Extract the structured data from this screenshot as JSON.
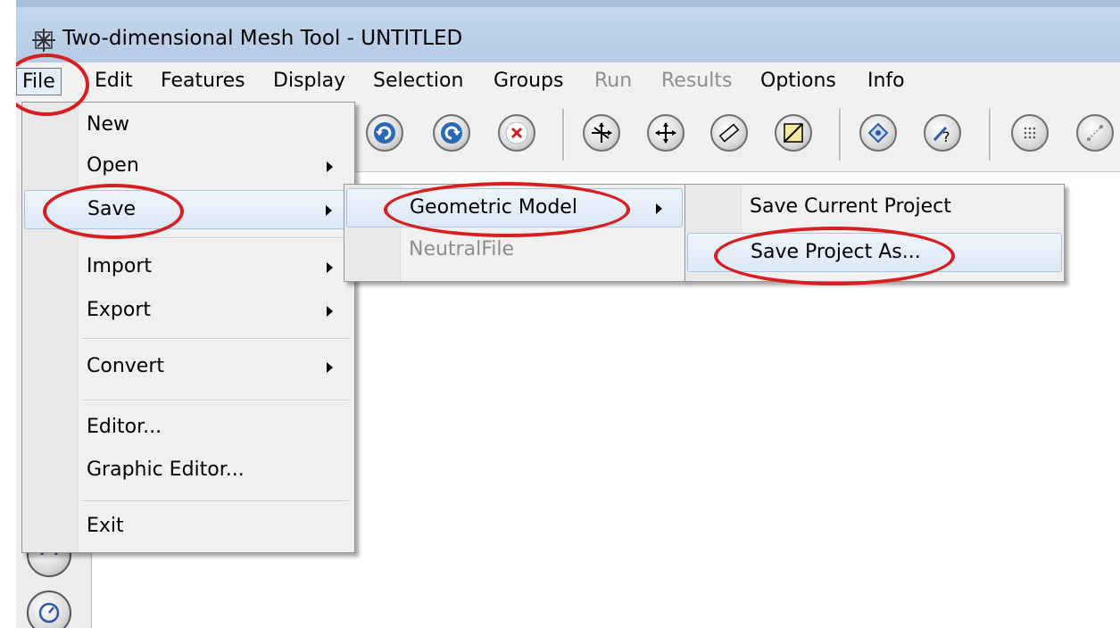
{
  "window": {
    "title": "Two-dimensional Mesh Tool - UNTITLED",
    "icon": "mesh-app-icon"
  },
  "menubar": {
    "items": [
      {
        "label": "File",
        "state": "active"
      },
      {
        "label": "Edit"
      },
      {
        "label": "Features"
      },
      {
        "label": "Display"
      },
      {
        "label": "Selection"
      },
      {
        "label": "Groups"
      },
      {
        "label": "Run",
        "state": "disabled"
      },
      {
        "label": "Results",
        "state": "disabled"
      },
      {
        "label": "Options"
      },
      {
        "label": "Info"
      }
    ]
  },
  "toolbar": {
    "buttons": [
      "undo-icon",
      "redo-icon",
      "delete-icon",
      "move-icon",
      "pan-icon",
      "measure-icon",
      "split-area-icon",
      "view-icon",
      "query-icon",
      "grid-icon",
      "snap-icon"
    ]
  },
  "file_menu": {
    "items": [
      {
        "label": "New"
      },
      {
        "label": "Open",
        "submenu": true
      },
      {
        "label": "Save",
        "submenu": true,
        "highlighted": true
      },
      {
        "label": "Import",
        "submenu": true
      },
      {
        "label": "Export",
        "submenu": true
      },
      {
        "label": "Convert",
        "submenu": true
      },
      {
        "label": "Editor..."
      },
      {
        "label": "Graphic Editor..."
      },
      {
        "label": "Exit"
      }
    ]
  },
  "save_submenu": {
    "items": [
      {
        "label": "Geometric Model",
        "submenu": true,
        "highlighted": true
      },
      {
        "label": "NeutralFile",
        "state": "disabled"
      }
    ]
  },
  "geometric_model_submenu": {
    "items": [
      {
        "label": "Save Current Project"
      },
      {
        "label": "Save Project As...",
        "highlighted": true
      }
    ]
  },
  "colors": {
    "annotation_ring": "#d81e1e",
    "highlight": "#dce8f6",
    "titlebar": "#b9cfe8"
  }
}
